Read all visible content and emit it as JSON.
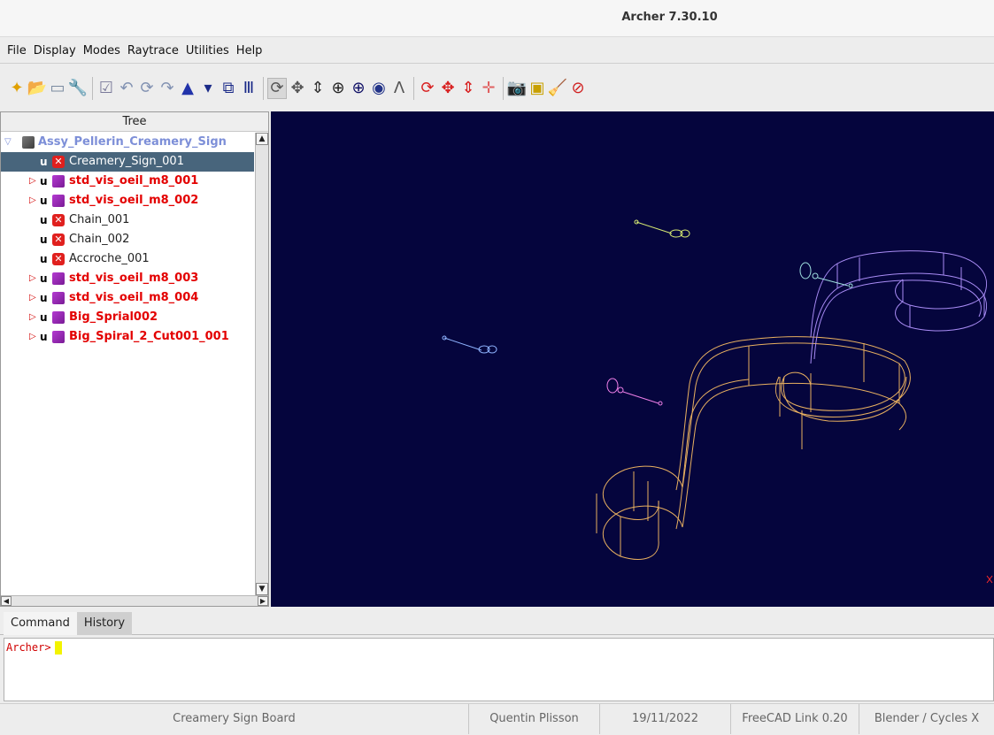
{
  "window": {
    "title": "Archer 7.30.10"
  },
  "menu": [
    "File",
    "Display",
    "Modes",
    "Raytrace",
    "Utilities",
    "Help"
  ],
  "toolbar": {
    "groups": [
      [
        {
          "icon": "new-db-icon",
          "glyph": "✦",
          "color": "#e0a000"
        },
        {
          "icon": "open-folder-icon",
          "glyph": "📂",
          "color": "#d88a00"
        },
        {
          "icon": "save-icon",
          "glyph": "▭",
          "color": "#7a8aa0"
        },
        {
          "icon": "wrench-icon",
          "glyph": "🔧",
          "color": "#6f7ea0"
        }
      ],
      [
        {
          "icon": "checkbox-icon",
          "glyph": "☑",
          "color": "#7a7a9a"
        },
        {
          "icon": "undo-icon",
          "glyph": "↶",
          "color": "#8292b2"
        },
        {
          "icon": "refresh-icon",
          "glyph": "⟳",
          "color": "#8292b2"
        },
        {
          "icon": "redo-icon",
          "glyph": "↷",
          "color": "#8292b2"
        },
        {
          "icon": "wizard-icon",
          "glyph": "▲",
          "color": "#2233aa"
        },
        {
          "icon": "dropdown-icon",
          "glyph": "▾",
          "color": "#1a2a88"
        },
        {
          "icon": "copy-object-icon",
          "glyph": "⧉",
          "color": "#1a2a88"
        },
        {
          "icon": "columns-icon",
          "glyph": "Ⅲ",
          "color": "#1a2a88"
        }
      ],
      [
        {
          "icon": "rotate-view-icon",
          "glyph": "⟳",
          "color": "#555555",
          "pressed": true
        },
        {
          "icon": "translate-view-icon",
          "glyph": "✥",
          "color": "#555555"
        },
        {
          "icon": "scale-view-icon",
          "glyph": "⇕",
          "color": "#333333"
        },
        {
          "icon": "center-view-icon",
          "glyph": "⊕",
          "color": "#222222"
        },
        {
          "icon": "center-object-icon",
          "glyph": "⊕",
          "color": "#111166"
        },
        {
          "icon": "cube-view-icon",
          "glyph": "◉",
          "color": "#223388"
        },
        {
          "icon": "measure-icon",
          "glyph": "Λ",
          "color": "#555555"
        }
      ],
      [
        {
          "icon": "rotate-object-icon",
          "glyph": "⟳",
          "color": "#d82020"
        },
        {
          "icon": "translate-object-icon",
          "glyph": "✥",
          "color": "#d82020"
        },
        {
          "icon": "scale-object-icon",
          "glyph": "⇕",
          "color": "#d82020"
        },
        {
          "icon": "center-point-icon",
          "glyph": "✛",
          "color": "#e06060"
        }
      ],
      [
        {
          "icon": "camera-icon",
          "glyph": "📷",
          "color": "#333333"
        },
        {
          "icon": "raytrace-icon",
          "glyph": "▣",
          "color": "#c8a000"
        },
        {
          "icon": "broom-icon",
          "glyph": "🧹",
          "color": "#d6a000"
        },
        {
          "icon": "stop-raytrace-icon",
          "glyph": "⊘",
          "color": "#d02020"
        }
      ]
    ]
  },
  "tree": {
    "header": "Tree",
    "items": [
      {
        "name": "Assy_Pellerin_Creamery_Sign",
        "type": "root",
        "expanded": true,
        "level": 0
      },
      {
        "name": "Creamery_Sign_001",
        "type": "prim",
        "prefix": "u",
        "selected": true,
        "level": 1
      },
      {
        "name": "std_vis_oeil_m8_001",
        "type": "comb",
        "prefix": "u",
        "level": 1
      },
      {
        "name": "std_vis_oeil_m8_002",
        "type": "comb",
        "prefix": "u",
        "level": 1
      },
      {
        "name": "Chain_001",
        "type": "prim",
        "prefix": "u",
        "level": 1
      },
      {
        "name": "Chain_002",
        "type": "prim",
        "prefix": "u",
        "level": 1
      },
      {
        "name": "Accroche_001",
        "type": "prim",
        "prefix": "u",
        "level": 1
      },
      {
        "name": "std_vis_oeil_m8_003",
        "type": "comb",
        "prefix": "u",
        "level": 1
      },
      {
        "name": "std_vis_oeil_m8_004",
        "type": "comb",
        "prefix": "u",
        "level": 1
      },
      {
        "name": "Big_Sprial002",
        "type": "comb",
        "prefix": "u",
        "level": 1
      },
      {
        "name": "Big_Spiral_2_Cut001_001",
        "type": "comb",
        "prefix": "u",
        "level": 1
      }
    ]
  },
  "viewport": {
    "background": "#05053d",
    "colors": {
      "orange_spiral": "#e8b060",
      "violet_spiral": "#a98cf5",
      "yellow_green_screw": "#d7ea72",
      "blue_screw": "#8fb4ff",
      "pink_screw": "#ef7fe8",
      "cyan_screw": "#9fe0e0",
      "axis_marker": "#ff2a2a"
    }
  },
  "console": {
    "tabs": [
      "Command",
      "History"
    ],
    "active_tab": "Command",
    "prompt": "Archer>"
  },
  "status": [
    "Creamery Sign Board",
    "Quentin Plisson",
    "19/11/2022",
    "FreeCAD Link 0.20",
    "Blender / Cycles X"
  ]
}
